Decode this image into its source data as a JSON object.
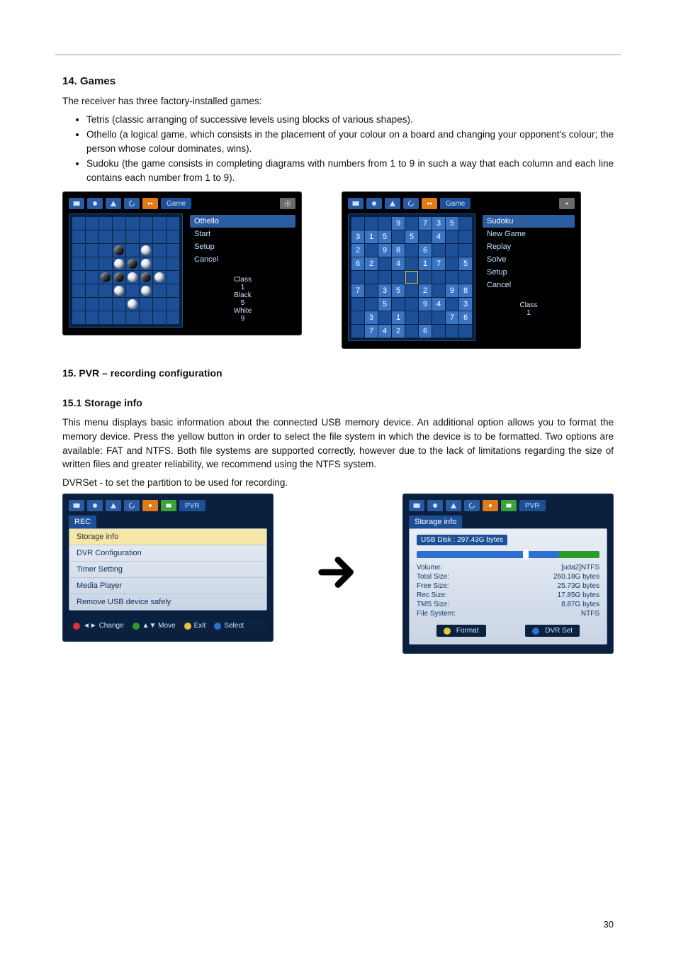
{
  "page_number": "30",
  "sections": {
    "games": {
      "heading": "14. Games",
      "intro": "The receiver has three factory-installed games:",
      "items": [
        "Tetris (classic arranging of successive levels using blocks of various shapes).",
        "Othello (a logical game, which consists in the placement of your colour on a board and changing your opponent's colour; the person whose colour dominates, wins).",
        "Sudoku (the game consists in completing diagrams with numbers from 1 to 9 in such a way that each column and each line contains each number from 1 to 9)."
      ]
    },
    "pvr": {
      "heading": "15. PVR – recording configuration",
      "sub_heading": "15.1 Storage info",
      "para1": "This menu displays basic information about the connected USB memory device. An additional option allows you to format the memory device. Press the yellow button in order to select the file system in which the device is to be formatted. Two options are available: FAT and NTFS. Both file systems are supported correctly, however due to the lack of limitations regarding the size of written files and greater reliability, we recommend using the NTFS system.",
      "para2": "DVRSet - to set the partition to be used for recording."
    }
  },
  "othello_shot": {
    "tag": "Game",
    "menu": [
      "Othello",
      "Start",
      "Setup",
      "Cancel"
    ],
    "stats": [
      {
        "label": "Class",
        "value": "1"
      },
      {
        "label": "Black",
        "value": "5"
      },
      {
        "label": "White",
        "value": "9"
      }
    ],
    "pieces": {
      "black": [
        [
          2,
          3
        ],
        [
          3,
          4
        ],
        [
          4,
          2
        ],
        [
          4,
          3
        ],
        [
          4,
          5
        ]
      ],
      "white": [
        [
          2,
          5
        ],
        [
          3,
          3
        ],
        [
          3,
          5
        ],
        [
          4,
          4
        ],
        [
          4,
          6
        ],
        [
          5,
          3
        ],
        [
          5,
          5
        ],
        [
          6,
          4
        ]
      ]
    }
  },
  "sudoku_shot": {
    "tag": "Game",
    "menu": [
      "Sudoku",
      "New Game",
      "Replay",
      "Solve",
      "Setup",
      "Cancel"
    ],
    "class_stat": {
      "label": "Class",
      "value": "1"
    },
    "grid": [
      [
        "",
        "",
        "",
        "9",
        "",
        "7",
        "3",
        "5",
        ""
      ],
      [
        "3",
        "1",
        "5",
        "",
        "5",
        "",
        "4",
        "",
        ""
      ],
      [
        "2",
        "",
        "9",
        "8",
        "",
        "6",
        "",
        "",
        ""
      ],
      [
        "6",
        "2",
        "",
        "4",
        "",
        "1",
        "7",
        "",
        "5"
      ],
      [
        "",
        "",
        "",
        "",
        "",
        "",
        "",
        "",
        ""
      ],
      [
        "7",
        "",
        "3",
        "5",
        "",
        "2",
        "",
        "9",
        "8"
      ],
      [
        "",
        "",
        "5",
        "",
        "",
        "9",
        "4",
        "",
        "3"
      ],
      [
        "",
        "3",
        "",
        "1",
        "",
        "",
        "",
        "7",
        "6"
      ],
      [
        "",
        "7",
        "4",
        "2",
        "",
        "6",
        "",
        "",
        ""
      ]
    ],
    "highlight": [
      4,
      4
    ]
  },
  "rec_shot": {
    "tag": "PVR",
    "panel": "REC",
    "items": [
      "Storage info",
      "DVR Configuration",
      "Timer Setting",
      "Media Player",
      "Remove USB device safely"
    ],
    "selected_index": 0,
    "hints": [
      {
        "color": "r",
        "arrows": "◄►",
        "label": "Change"
      },
      {
        "color": "g",
        "arrows": "▲▼",
        "label": "Move"
      },
      {
        "color": "y",
        "arrows": "",
        "label": "Exit"
      },
      {
        "color": "b",
        "arrows": "",
        "label": "Select"
      }
    ]
  },
  "storage_shot": {
    "tag": "PVR",
    "panel": "Storage info",
    "disk": "USB Disk : 297.43G bytes",
    "rows": [
      {
        "k": "Volume:",
        "v": "[uda2]NTFS"
      },
      {
        "k": "Total Size:",
        "v": "260.18G bytes"
      },
      {
        "k": "Free Size:",
        "v": "25.73G bytes"
      },
      {
        "k": "Rec Size:",
        "v": "17.85G bytes"
      },
      {
        "k": "TMS Size:",
        "v": "8.87G bytes"
      },
      {
        "k": "File System:",
        "v": "NTFS"
      }
    ],
    "buttons": [
      {
        "dot": "y",
        "label": "Format"
      },
      {
        "dot": "b",
        "label": "DVR Set"
      }
    ]
  },
  "icons": {
    "tv": "tv",
    "sat": "sat",
    "ant": "ant",
    "loop": "loop",
    "globe": "globe",
    "game": "game",
    "gear": "gear"
  }
}
